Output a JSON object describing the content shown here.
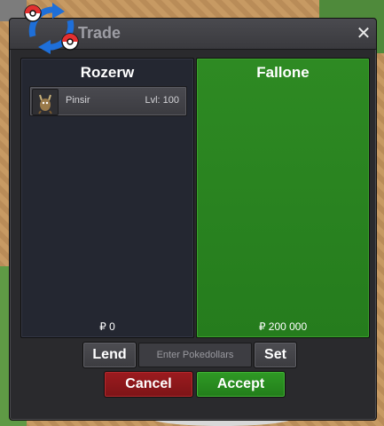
{
  "window": {
    "title": "Trade",
    "close_icon": "close-icon"
  },
  "left_panel": {
    "player": "Rozerw",
    "money": "₽ 0",
    "items": [
      {
        "name": "Pinsir",
        "level": "Lvl: 100",
        "icon": "pinsir-sprite-icon"
      }
    ]
  },
  "right_panel": {
    "player": "Fallone",
    "money": "₽ 200 000"
  },
  "controls": {
    "lend_label": "Lend",
    "pokedollars_placeholder": "Enter Pokedollars",
    "set_label": "Set",
    "cancel_label": "Cancel",
    "accept_label": "Accept"
  },
  "colors": {
    "accept": "#2f9a25",
    "cancel": "#9c1b1f",
    "partner_panel": "#2e8a23"
  }
}
